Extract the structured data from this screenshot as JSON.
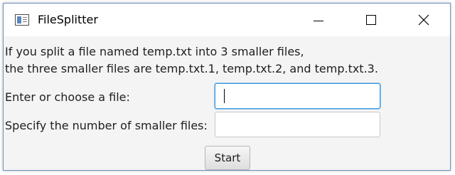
{
  "window": {
    "title": "FileSplitter",
    "app_icon": "app-window-icon",
    "minimize_icon": "minimize-icon",
    "maximize_icon": "maximize-icon",
    "close_icon": "close-icon"
  },
  "description": {
    "line1": "If you split a file named temp.txt into 3 smaller files,",
    "line2": "the three smaller files are temp.txt.1, temp.txt.2, and temp.txt.3."
  },
  "form": {
    "file_label": "Enter or choose a file:",
    "file_value": "",
    "count_label": "Specify the number of smaller files:",
    "count_value": "",
    "start_label": "Start"
  },
  "colors": {
    "focus_border": "#3f9be0",
    "window_border": "#6f91bd"
  }
}
